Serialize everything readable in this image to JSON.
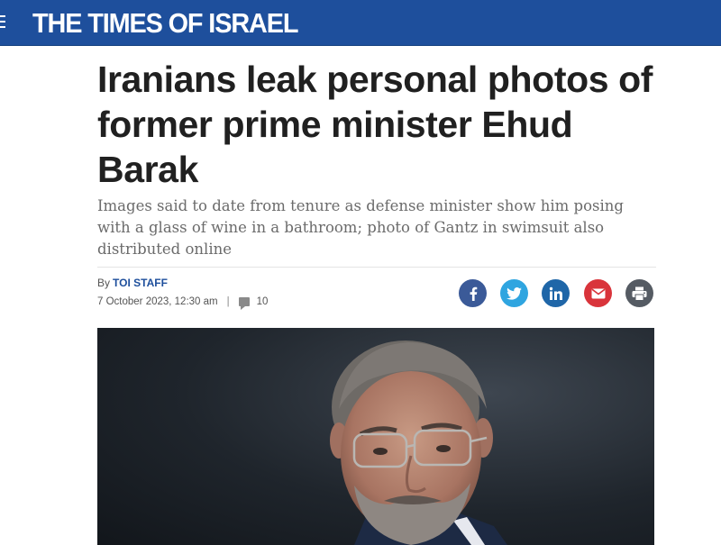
{
  "header": {
    "logo": "THE TIMES OF ISRAEL",
    "brand_color": "#1e4f9c",
    "menu_icon": "hamburger-menu-icon"
  },
  "article": {
    "headline": "Iranians leak personal photos of former prime minister Ehud Barak",
    "subheadline": "Images said to date from tenure as defense minister show him posing with a glass of wine in a bathroom; photo of Gantz in swimsuit also distributed online",
    "byline_prefix": "By",
    "author": "TOI STAFF",
    "date": "7 October 2023, 12:30 am",
    "separator": "|",
    "comment_count": "10"
  },
  "share": [
    {
      "name": "facebook",
      "icon": "facebook-icon",
      "color": "#3b5a98"
    },
    {
      "name": "twitter",
      "icon": "twitter-icon",
      "color": "#2fa5e0"
    },
    {
      "name": "linkedin",
      "icon": "linkedin-icon",
      "color": "#1f66a8"
    },
    {
      "name": "email",
      "icon": "email-icon",
      "color": "#d9343b"
    },
    {
      "name": "print",
      "icon": "print-icon",
      "color": "#555b63"
    }
  ]
}
